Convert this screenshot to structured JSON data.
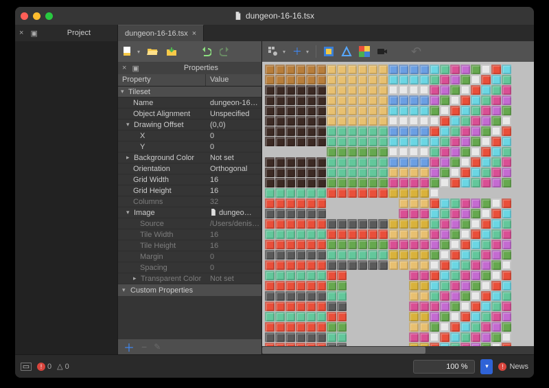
{
  "window": {
    "title": "dungeon-16-16.tsx"
  },
  "dock": {
    "project_title": "Project"
  },
  "file_tab": {
    "label": "dungeon-16-16.tsx"
  },
  "properties": {
    "panel_title": "Properties",
    "col_key": "Property",
    "col_val": "Value",
    "tileset_label": "Tileset",
    "name": {
      "label": "Name",
      "value": "dungeon-16…"
    },
    "object_alignment": {
      "label": "Object Alignment",
      "value": "Unspecified"
    },
    "drawing_offset": {
      "label": "Drawing Offset",
      "value": "(0,0)"
    },
    "offset_x": {
      "label": "X",
      "value": "0"
    },
    "offset_y": {
      "label": "Y",
      "value": "0"
    },
    "background_color": {
      "label": "Background Color",
      "value": "Not set"
    },
    "orientation": {
      "label": "Orientation",
      "value": "Orthogonal"
    },
    "grid_width": {
      "label": "Grid Width",
      "value": "16"
    },
    "grid_height": {
      "label": "Grid Height",
      "value": "16"
    },
    "columns": {
      "label": "Columns",
      "value": "32"
    },
    "image": {
      "label": "Image",
      "value": "dungeo…"
    },
    "source": {
      "label": "Source",
      "value": "/Users/denis…"
    },
    "tile_width": {
      "label": "Tile Width",
      "value": "16"
    },
    "tile_height": {
      "label": "Tile Height",
      "value": "16"
    },
    "margin": {
      "label": "Margin",
      "value": "0"
    },
    "spacing": {
      "label": "Spacing",
      "value": "0"
    },
    "transparent_color": {
      "label": "Transparent Color",
      "value": "Not set"
    },
    "custom_label": "Custom Properties"
  },
  "statusbar": {
    "errors": "0",
    "warnings": "0",
    "zoom": "100 %",
    "news": "News"
  },
  "icons": {
    "new": "new-file",
    "open": "open-file",
    "save": "save-file",
    "undo": "undo",
    "redo": "redo",
    "tools": "prefs",
    "add": "add",
    "rect": "rect-select",
    "trans": "blueshape",
    "shape": "color-shape",
    "camera": "camera",
    "back": "back"
  }
}
